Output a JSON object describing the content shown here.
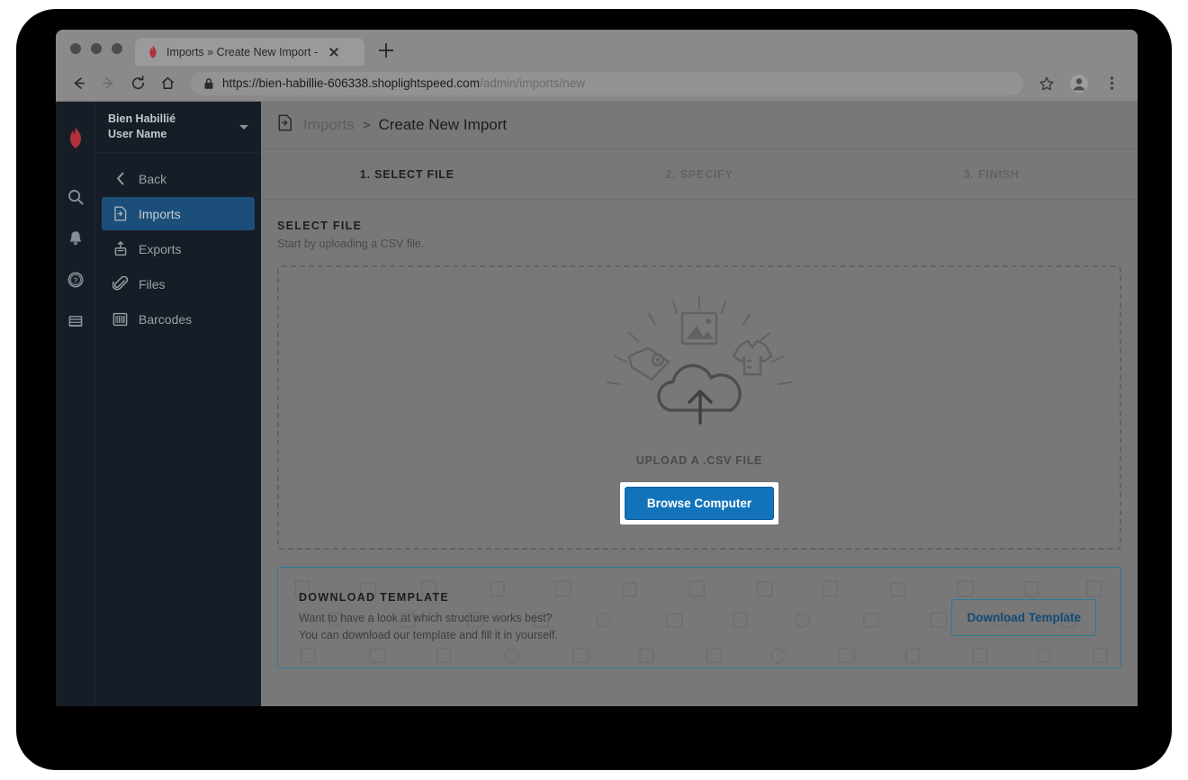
{
  "browser": {
    "tab": {
      "title": "Imports » Create New Import -",
      "favicon": "lightspeed-flame-icon"
    },
    "new_tab_label": "+",
    "url_domain": "https://bien-habillie-606338.shoplightspeed.com",
    "url_path": "/admin/imports/new",
    "lock_icon": "lock-icon",
    "controls": {
      "back": "back-arrow-icon",
      "forward": "forward-arrow-icon",
      "reload": "reload-icon",
      "home": "home-icon",
      "bookmark": "star-icon",
      "profile": "avatar-icon",
      "menu": "kebab-menu-icon"
    }
  },
  "rail": {
    "logo": "lightspeed-logo",
    "icons": [
      "search-icon",
      "bell-icon",
      "help-icon",
      "browser-window-icon"
    ]
  },
  "sidebar": {
    "account": {
      "shop": "Bien Habillié",
      "user": "User Name"
    },
    "items": [
      {
        "label": "Back",
        "icon": "chevron-left-icon",
        "active": false
      },
      {
        "label": "Imports",
        "icon": "import-file-icon",
        "active": true
      },
      {
        "label": "Exports",
        "icon": "export-upload-icon",
        "active": false
      },
      {
        "label": "Files",
        "icon": "paperclip-icon",
        "active": false
      },
      {
        "label": "Barcodes",
        "icon": "barcode-icon",
        "active": false
      }
    ]
  },
  "header": {
    "icon": "import-file-icon",
    "breadcrumb_parent": "Imports",
    "breadcrumb_separator": ">",
    "breadcrumb_current": "Create New Import"
  },
  "steps": [
    {
      "label": "1. SELECT FILE",
      "active": true
    },
    {
      "label": "2. SPECIFY",
      "active": false
    },
    {
      "label": "3. FINISH",
      "active": false
    }
  ],
  "select_file": {
    "title": "SELECT FILE",
    "subtitle": "Start by uploading a CSV file.",
    "dropzone_label": "UPLOAD A .CSV FILE",
    "browse_button": "Browse Computer"
  },
  "download_template": {
    "title": "DOWNLOAD TEMPLATE",
    "line1": "Want to have a look at which structure works best?",
    "line2": "You can download our template and fill it in yourself.",
    "button": "Download Template"
  },
  "colors": {
    "accent_blue": "#1373ba",
    "panel_border_teal": "#2c7a94",
    "sidebar_bg": "#161d26",
    "sidebar_active": "#1b4f7a",
    "overlay_gray": "#787878",
    "logo_red": "#b0313b"
  }
}
